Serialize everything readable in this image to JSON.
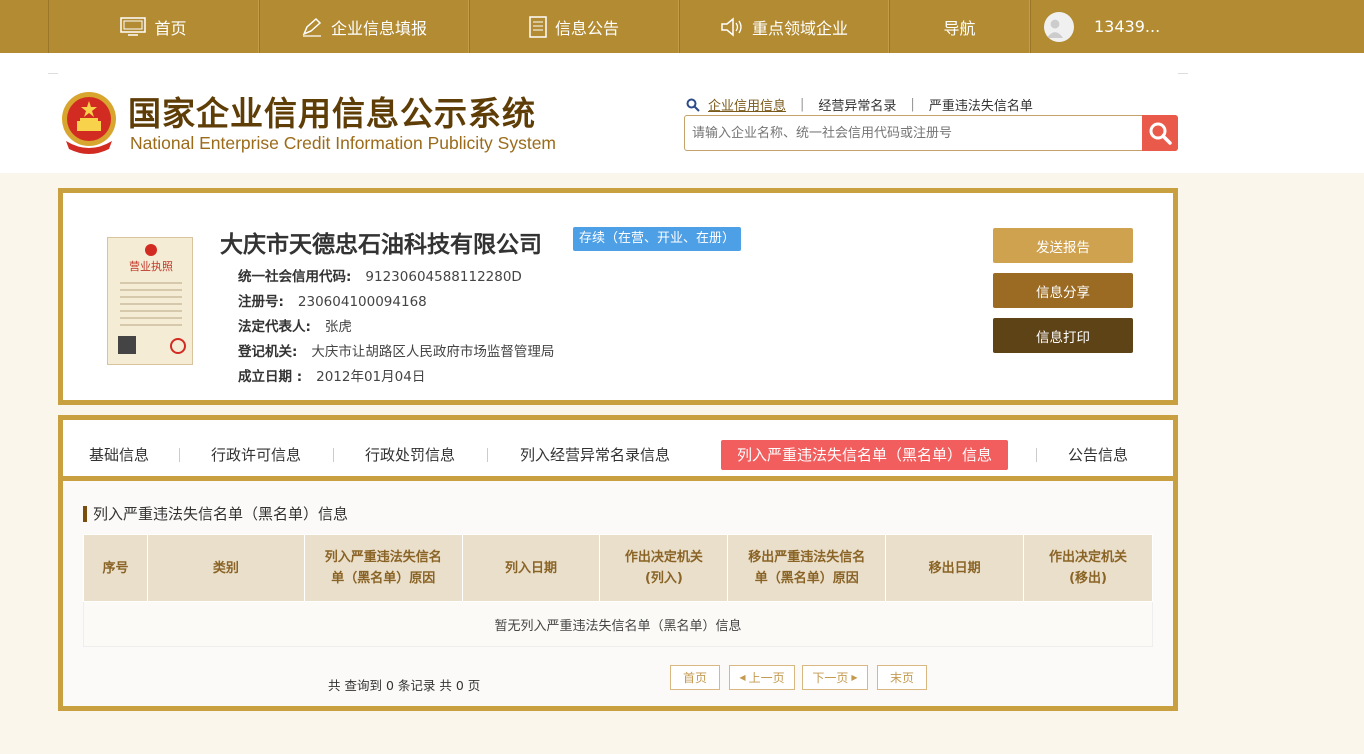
{
  "nav": {
    "home": "首页",
    "fill": "企业信息填报",
    "notice": "信息公告",
    "key": "重点领域企业",
    "navi": "导航",
    "user": "13439..."
  },
  "header": {
    "title_cn": "国家企业信用信息公示系统",
    "title_en": "National Enterprise Credit Information Publicity System",
    "links": [
      "企业信用信息",
      "经营异常名录",
      "严重违法失信名单"
    ],
    "search_placeholder": "请输入企业名称、统一社会信用代码或注册号"
  },
  "company": {
    "name": "大庆市天德忠石油科技有限公司",
    "status": "存续（在营、开业、在册）",
    "license_title": "营业执照",
    "fields": [
      {
        "label": "统一社会信用代码:",
        "value": "91230604588112280D"
      },
      {
        "label": "注册号:",
        "value": "230604100094168"
      },
      {
        "label": "法定代表人:",
        "value": "张虎"
      },
      {
        "label": "登记机关:",
        "value": "大庆市让胡路区人民政府市场监督管理局"
      },
      {
        "label": "成立日期 :",
        "value": "2012年01月04日"
      }
    ],
    "buttons": [
      "发送报告",
      "信息分享",
      "信息打印"
    ]
  },
  "tabs": [
    "基础信息",
    "行政许可信息",
    "行政处罚信息",
    "列入经营异常名录信息",
    "列入严重违法失信名单（黑名单）信息",
    "公告信息"
  ],
  "section": {
    "title": "列入严重违法失信名单（黑名单）信息",
    "columns": [
      [
        "序号"
      ],
      [
        "类别"
      ],
      [
        "列入严重违法失信名",
        "单（黑名单）原因"
      ],
      [
        "列入日期"
      ],
      [
        "作出决定机关",
        "(列入)"
      ],
      [
        "移出严重违法失信名",
        "单（黑名单）原因"
      ],
      [
        "移出日期"
      ],
      [
        "作出决定机关",
        "(移出)"
      ]
    ],
    "empty": "暂无列入严重违法失信名单（黑名单）信息",
    "total": "共 查询到 0 条记录 共 0 页",
    "pager": [
      "首页",
      "上一页",
      "下一页",
      "末页"
    ]
  },
  "colors": {
    "nav": "#b28b33",
    "gold_border": "#c9a03f",
    "active_tab": "#f25d5d",
    "status_badge": "#4d9fe6"
  }
}
